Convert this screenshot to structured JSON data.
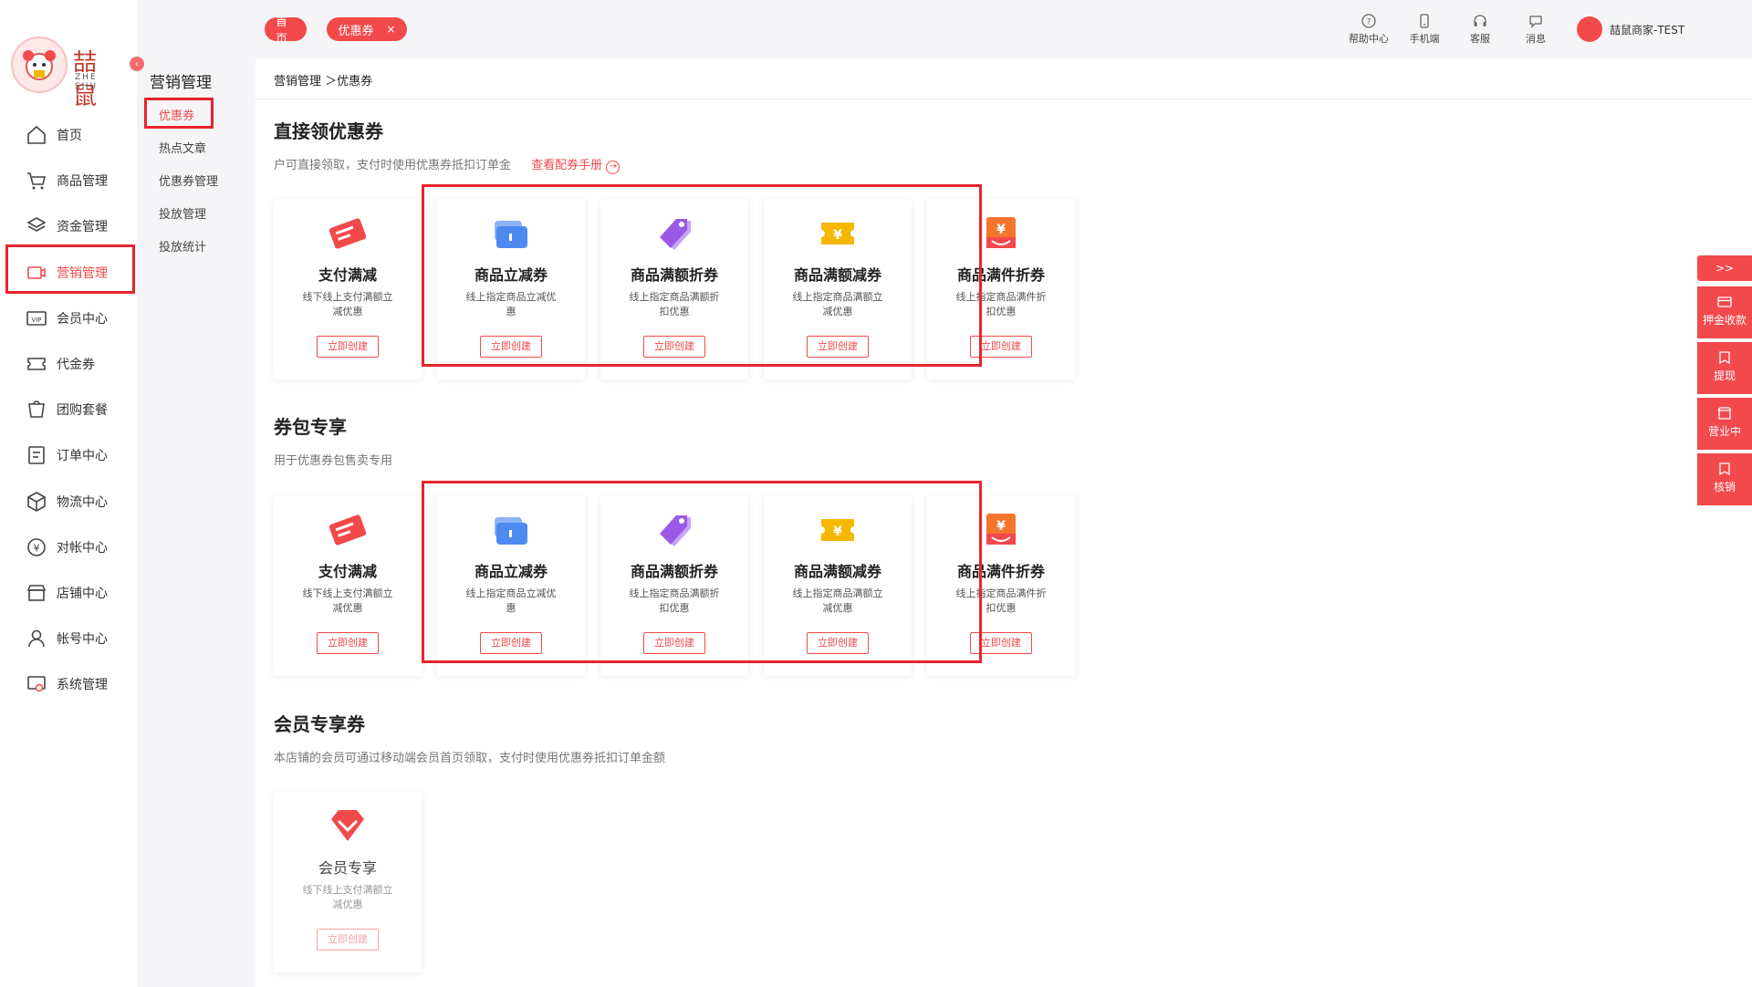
{
  "brand": {
    "cn": "喆鼠",
    "en": "ZHE SHU"
  },
  "sidebar": {
    "items": [
      {
        "label": "首页",
        "icon": "home-icon"
      },
      {
        "label": "商品管理",
        "icon": "cart-icon"
      },
      {
        "label": "资金管理",
        "icon": "layers-icon"
      },
      {
        "label": "营销管理",
        "icon": "marketing-icon"
      },
      {
        "label": "会员中心",
        "icon": "vip-icon"
      },
      {
        "label": "代金券",
        "icon": "voucher-icon"
      },
      {
        "label": "团购套餐",
        "icon": "group-buy-icon"
      },
      {
        "label": "订单中心",
        "icon": "order-icon"
      },
      {
        "label": "物流中心",
        "icon": "box-icon"
      },
      {
        "label": "对帐中心",
        "icon": "yen-icon"
      },
      {
        "label": "店铺中心",
        "icon": "store-icon"
      },
      {
        "label": "帐号中心",
        "icon": "user-icon"
      },
      {
        "label": "系统管理",
        "icon": "settings-icon"
      }
    ],
    "active_index": 3
  },
  "subnav": {
    "title": "营销管理",
    "items": [
      "优惠券",
      "热点文章",
      "优惠券管理",
      "投放管理",
      "投放统计"
    ],
    "active_index": 0
  },
  "topbar": {
    "tabs": [
      {
        "label": "首页"
      },
      {
        "label": "优惠券",
        "close": "×"
      }
    ],
    "actions": [
      "帮助中心",
      "手机端",
      "客服",
      "消息"
    ],
    "user_name": "喆鼠商家-TEST"
  },
  "breadcrumb": "营销管理 ＞优惠券",
  "sections": [
    {
      "title": "直接领优惠券",
      "desc": "户可直接领取，支付时使用优惠券抵扣订单金",
      "link": "查看配券手册",
      "link_icon": "→",
      "cards": [
        {
          "title": "支付满减",
          "desc": "线下线上支付满额立减优惠",
          "button": "立即创建",
          "icon": "ticket-red-icon"
        },
        {
          "title": "商品立减券",
          "desc": "线上指定商品立减优惠",
          "button": "立即创建",
          "icon": "wallet-blue-icon"
        },
        {
          "title": "商品满额折券",
          "desc": "线上指定商品满额折扣优惠",
          "button": "立即创建",
          "icon": "tag-purple-icon"
        },
        {
          "title": "商品满额减券",
          "desc": "线上指定商品满额立减优惠",
          "button": "立即创建",
          "icon": "yen-ticket-yellow-icon"
        },
        {
          "title": "商品满件折券",
          "desc": "线上指定商品满件折扣优惠",
          "button": "立即创建",
          "icon": "yen-box-orange-icon"
        }
      ]
    },
    {
      "title": "券包专享",
      "desc": "用于优惠券包售卖专用",
      "cards": [
        {
          "title": "支付满减",
          "desc": "线下线上支付满额立减优惠",
          "button": "立即创建",
          "icon": "ticket-red-icon"
        },
        {
          "title": "商品立减券",
          "desc": "线上指定商品立减优惠",
          "button": "立即创建",
          "icon": "wallet-blue-icon"
        },
        {
          "title": "商品满额折券",
          "desc": "线上指定商品满额折扣优惠",
          "button": "立即创建",
          "icon": "tag-purple-icon"
        },
        {
          "title": "商品满额减券",
          "desc": "线上指定商品满额立减优惠",
          "button": "立即创建",
          "icon": "yen-ticket-yellow-icon"
        },
        {
          "title": "商品满件折券",
          "desc": "线上指定商品满件折扣优惠",
          "button": "立即创建",
          "icon": "yen-box-orange-icon"
        }
      ]
    },
    {
      "title": "会员专享券",
      "desc": "本店铺的会员可通过移动端会员首页领取，支付时使用优惠券抵扣订单金额",
      "cards": [
        {
          "title": "会员专享",
          "desc": "线下线上支付满额立减优惠",
          "button": "立即创建",
          "icon": "diamond-red-icon",
          "disabled": true
        }
      ]
    }
  ],
  "right_panel": {
    "toggle": ">>",
    "items": [
      "押金收款",
      "提现",
      "营业中",
      "核销"
    ]
  },
  "colors": {
    "accent": "#f2494b",
    "highlight": "#e8242c"
  }
}
